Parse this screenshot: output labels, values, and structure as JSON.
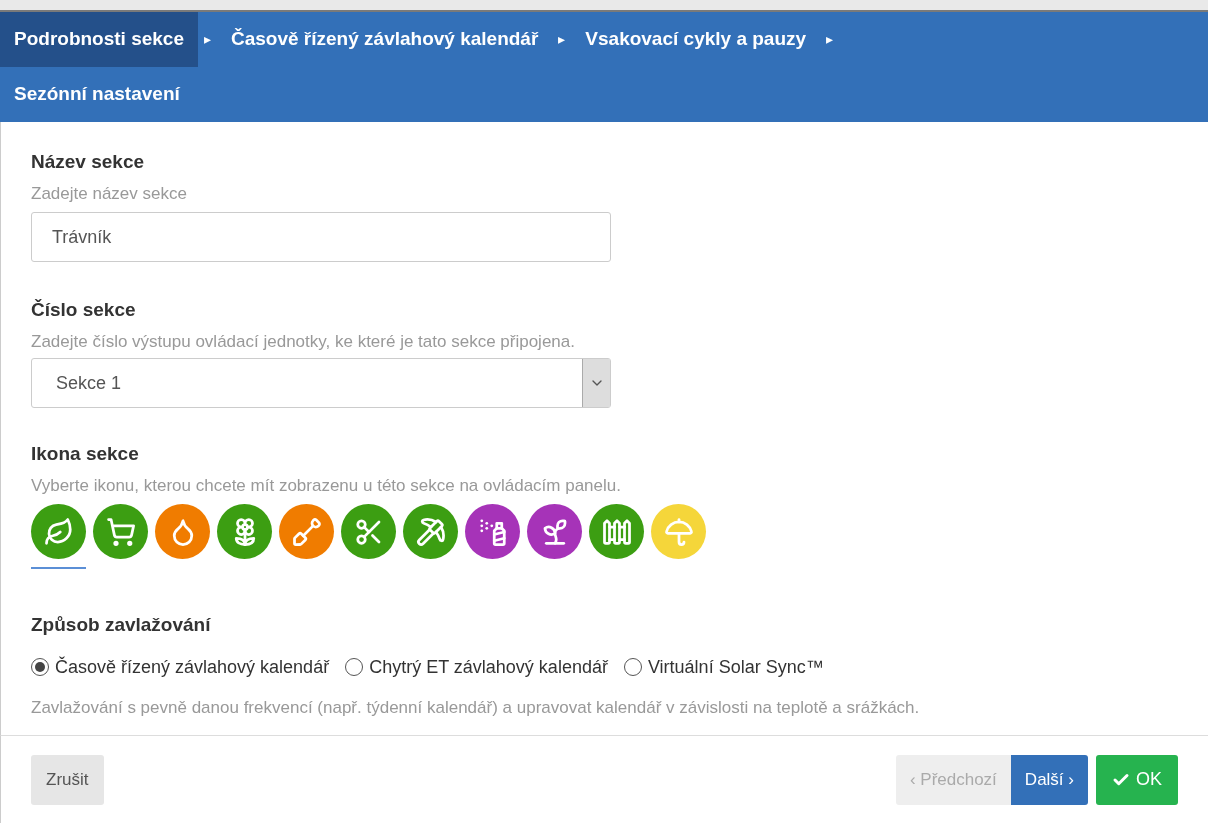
{
  "tabs": [
    {
      "label": "Podrobnosti sekce",
      "selected": true,
      "arrow": "▸"
    },
    {
      "label": "Časově řízený závlahový kalendář",
      "selected": false,
      "arrow": "▸"
    },
    {
      "label": "Vsakovací cykly a pauzy",
      "selected": false,
      "arrow": "▸"
    },
    {
      "label": "Sezónní nastavení",
      "selected": false
    }
  ],
  "name_field": {
    "label": "Název sekce",
    "help": "Zadejte název sekce",
    "value": "Trávník"
  },
  "number_field": {
    "label": "Číslo sekce",
    "help": "Zadejte číslo výstupu ovládací jednotky, ke které je tato sekce připojena.",
    "value": "Sekce 1"
  },
  "icon_picker": {
    "label": "Ikona sekce",
    "help": "Vyberte ikonu, kterou chcete mít zobrazenu u této sekce na ovládacím panelu.",
    "icons": [
      {
        "color": "#3c9e12",
        "selected": true
      },
      {
        "color": "#3c9e12",
        "selected": false
      },
      {
        "color": "#f07c00",
        "selected": false
      },
      {
        "color": "#3c9e12",
        "selected": false
      },
      {
        "color": "#f07c00",
        "selected": false
      },
      {
        "color": "#3c9e12",
        "selected": false
      },
      {
        "color": "#3c9e12",
        "selected": false
      },
      {
        "color": "#a633b8",
        "selected": false
      },
      {
        "color": "#a633b8",
        "selected": false
      },
      {
        "color": "#3c9e12",
        "selected": false
      },
      {
        "color": "#f5d63a",
        "selected": false
      }
    ]
  },
  "irrigation": {
    "label": "Způsob zavlažování",
    "options": [
      {
        "label": "Časově řízený závlahový kalendář",
        "selected": true
      },
      {
        "label": "Chytrý ET závlahový kalendář",
        "selected": false
      },
      {
        "label": "Virtuální Solar Sync™",
        "selected": false
      }
    ],
    "description": "Zavlažování s pevně danou frekvencí (např. týdenní kalendář) a upravovat kalendář v závislosti na teplotě a srážkách."
  },
  "footer": {
    "cancel": "Zrušit",
    "previous": {
      "label": "‹ Předchozí",
      "disabled": true
    },
    "next": {
      "label": "Další ›",
      "disabled": false
    },
    "ok": {
      "label": "OK"
    }
  }
}
